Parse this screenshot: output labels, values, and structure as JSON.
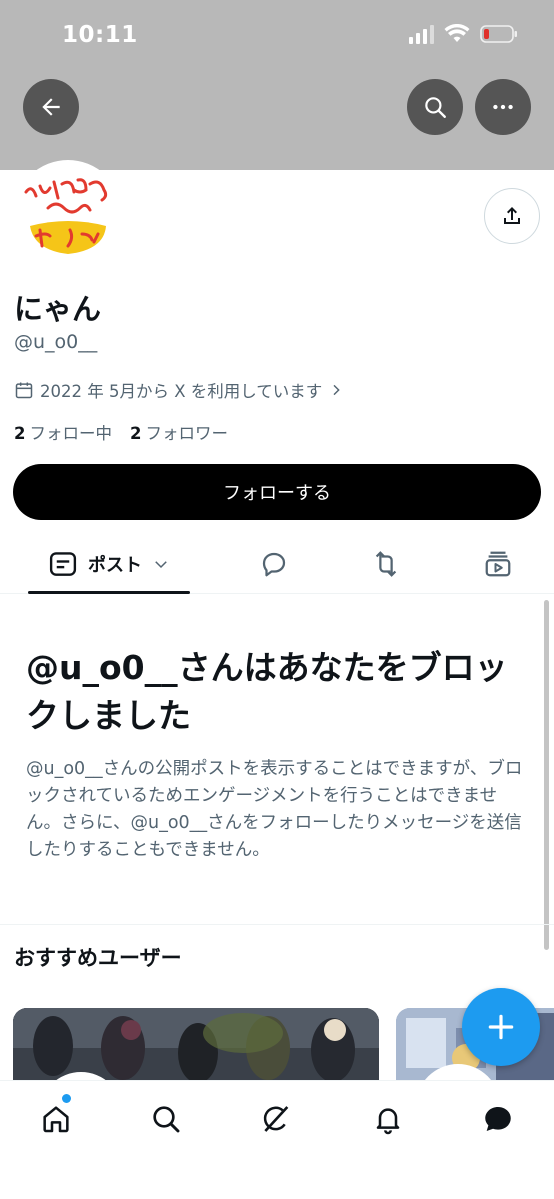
{
  "status_bar": {
    "time": "10:11",
    "icons": [
      "signal-icon",
      "wifi-icon",
      "battery-low-icon"
    ]
  },
  "header": {
    "back_icon": "arrow-left-icon",
    "search_icon": "search-icon",
    "more_icon": "more-horizontal-icon",
    "share_icon": "share-icon"
  },
  "profile": {
    "display_name": "にゃん",
    "handle": "@u_o0__",
    "joined": "2022 年 5月から X を利用しています",
    "following_count": "2",
    "following_label": "フォロー中",
    "followers_count": "2",
    "followers_label": "フォロワー",
    "avatar_lettering": "パンチ パカッ"
  },
  "follow_button": {
    "label": "フォローする"
  },
  "tabs": {
    "posts_label": "ポスト",
    "items": [
      "posts",
      "replies-icon",
      "repost-icon",
      "media-icon"
    ]
  },
  "blocked": {
    "title": "@u_o0__さんはあなたをブロックしました",
    "description": "@u_o0__さんの公開ポストを表示することはできますが、ブロックされているためエンゲージメントを行うことはできません。さらに、@u_o0__さんをフォローしたりメッセージを送信したりすることもできません。"
  },
  "recommendations": {
    "title": "おすすめユーザー"
  },
  "bottom_nav": {
    "items": [
      "home-icon",
      "search-icon",
      "grok-icon",
      "notifications-icon",
      "messages-icon"
    ]
  },
  "colors": {
    "accent": "#1d9bf0",
    "text_primary": "#0f1419",
    "text_secondary": "#536471",
    "banner": "#b8b8b8",
    "follow_button": "#000000"
  }
}
